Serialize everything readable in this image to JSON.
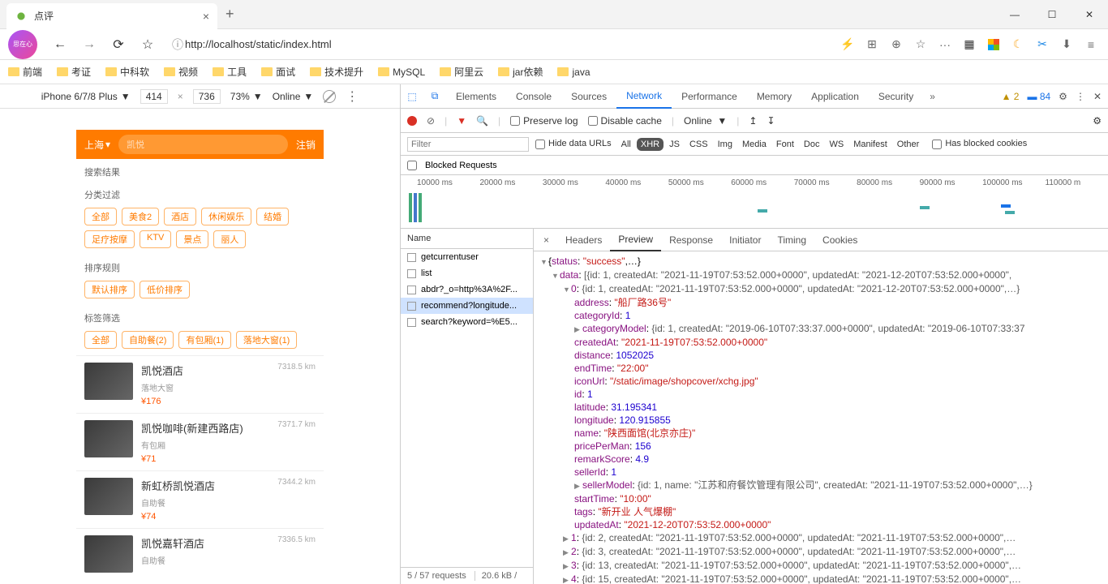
{
  "browser": {
    "tab_title": "点评",
    "url": "http://localhost/static/index.html",
    "bookmarks": [
      "前端",
      "考证",
      "中科软",
      "视频",
      "工具",
      "面试",
      "技术提升",
      "MySQL",
      "阿里云",
      "jar依赖",
      "java"
    ]
  },
  "device_bar": {
    "device": "iPhone 6/7/8 Plus",
    "width": "414",
    "height": "736",
    "zoom": "73%",
    "throttle": "Online"
  },
  "app": {
    "city": "上海",
    "search_placeholder": "凯悦",
    "logout": "注销",
    "sections": {
      "search_result": "搜索结果",
      "category_filter": "分类过滤",
      "sort_rule": "排序规则",
      "tag_filter": "标签筛选"
    },
    "category_tags": [
      "全部",
      "美食2",
      "酒店",
      "休闲娱乐",
      "结婚",
      "足疗按摩",
      "KTV",
      "景点",
      "丽人"
    ],
    "sort_tags": [
      "默认排序",
      "低价排序"
    ],
    "label_tags": [
      "全部",
      "自助餐(2)",
      "有包厢(1)",
      "落地大窗(1)"
    ],
    "shops": [
      {
        "name": "凯悦酒店",
        "tag": "落地大窗",
        "price": "¥176",
        "distance": "7318.5 km"
      },
      {
        "name": "凯悦咖啡(新建西路店)",
        "tag": "有包厢",
        "price": "¥71",
        "distance": "7371.7 km"
      },
      {
        "name": "新虹桥凯悦酒店",
        "tag": "自助餐",
        "price": "¥74",
        "distance": "7344.2 km"
      },
      {
        "name": "凯悦嘉轩酒店",
        "tag": "自助餐",
        "price": "",
        "distance": "7336.5 km"
      }
    ]
  },
  "devtools": {
    "tabs": [
      "Elements",
      "Console",
      "Sources",
      "Network",
      "Performance",
      "Memory",
      "Application",
      "Security"
    ],
    "active_tab": "Network",
    "warnings": "2",
    "messages": "84",
    "toolbar": {
      "preserve_log": "Preserve log",
      "disable_cache": "Disable cache",
      "online": "Online"
    },
    "filter_placeholder": "Filter",
    "hide_data_urls": "Hide data URLs",
    "filter_types": [
      "All",
      "XHR",
      "JS",
      "CSS",
      "Img",
      "Media",
      "Font",
      "Doc",
      "WS",
      "Manifest",
      "Other"
    ],
    "active_filter": "XHR",
    "has_blocked": "Has blocked cookies",
    "blocked_requests": "Blocked Requests",
    "timeline_labels": [
      "10000 ms",
      "20000 ms",
      "30000 ms",
      "40000 ms",
      "50000 ms",
      "60000 ms",
      "70000 ms",
      "80000 ms",
      "90000 ms",
      "100000 ms",
      "110000 m"
    ],
    "requests": {
      "header": "Name",
      "items": [
        "getcurrentuser",
        "list",
        "abdr?_o=http%3A%2F...",
        "recommend?longitude...",
        "search?keyword=%E5..."
      ],
      "selected_index": 3,
      "footer_count": "5 / 57 requests",
      "footer_size": "20.6 kB /"
    },
    "detail_tabs": [
      "Headers",
      "Preview",
      "Response",
      "Initiator",
      "Timing",
      "Cookies"
    ],
    "active_detail": "Preview"
  },
  "chart_data": {
    "type": "table",
    "title": "JSON response preview",
    "root": {
      "status": "success"
    },
    "data_header": "[{id: 1, createdAt: \"2021-11-19T07:53:52.000+0000\", updatedAt: \"2021-12-20T07:53:52.000+0000\",",
    "item0_header": "{id: 1, createdAt: \"2021-11-19T07:53:52.000+0000\", updatedAt: \"2021-12-20T07:53:52.000+0000\",…}",
    "item0": {
      "address": "船厂路36号",
      "categoryId": 1,
      "categoryModel": "{id: 1, createdAt: \"2019-06-10T07:33:37.000+0000\", updatedAt: \"2019-06-10T07:33:37",
      "createdAt": "2021-11-19T07:53:52.000+0000",
      "distance": 1052025,
      "endTime": "22:00",
      "iconUrl": "/static/image/shopcover/xchg.jpg",
      "id": 1,
      "latitude": 31.195341,
      "longitude": 120.915855,
      "name": "陕西面馆(北京亦庄)",
      "pricePerMan": 156,
      "remarkScore": 4.9,
      "sellerId": 1,
      "sellerModel": "{id: 1, name: \"江苏和府餐饮管理有限公司\", createdAt: \"2021-11-19T07:53:52.000+0000\",…}",
      "startTime": "10:00",
      "tags": "新开业 人气爆棚",
      "updatedAt": "2021-12-20T07:53:52.000+0000"
    },
    "rest": [
      {
        "idx": "1",
        "line": "{id: 2, createdAt: \"2021-11-19T07:53:52.000+0000\", updatedAt: \"2021-11-19T07:53:52.000+0000\",…"
      },
      {
        "idx": "2",
        "line": "{id: 3, createdAt: \"2021-11-19T07:53:52.000+0000\", updatedAt: \"2021-11-19T07:53:52.000+0000\",…"
      },
      {
        "idx": "3",
        "line": "{id: 13, createdAt: \"2021-11-19T07:53:52.000+0000\", updatedAt: \"2021-11-19T07:53:52.000+0000\",…"
      },
      {
        "idx": "4",
        "line": "{id: 15, createdAt: \"2021-11-19T07:53:52.000+0000\", updatedAt: \"2021-11-19T07:53:52.000+0000\",…"
      }
    ]
  }
}
